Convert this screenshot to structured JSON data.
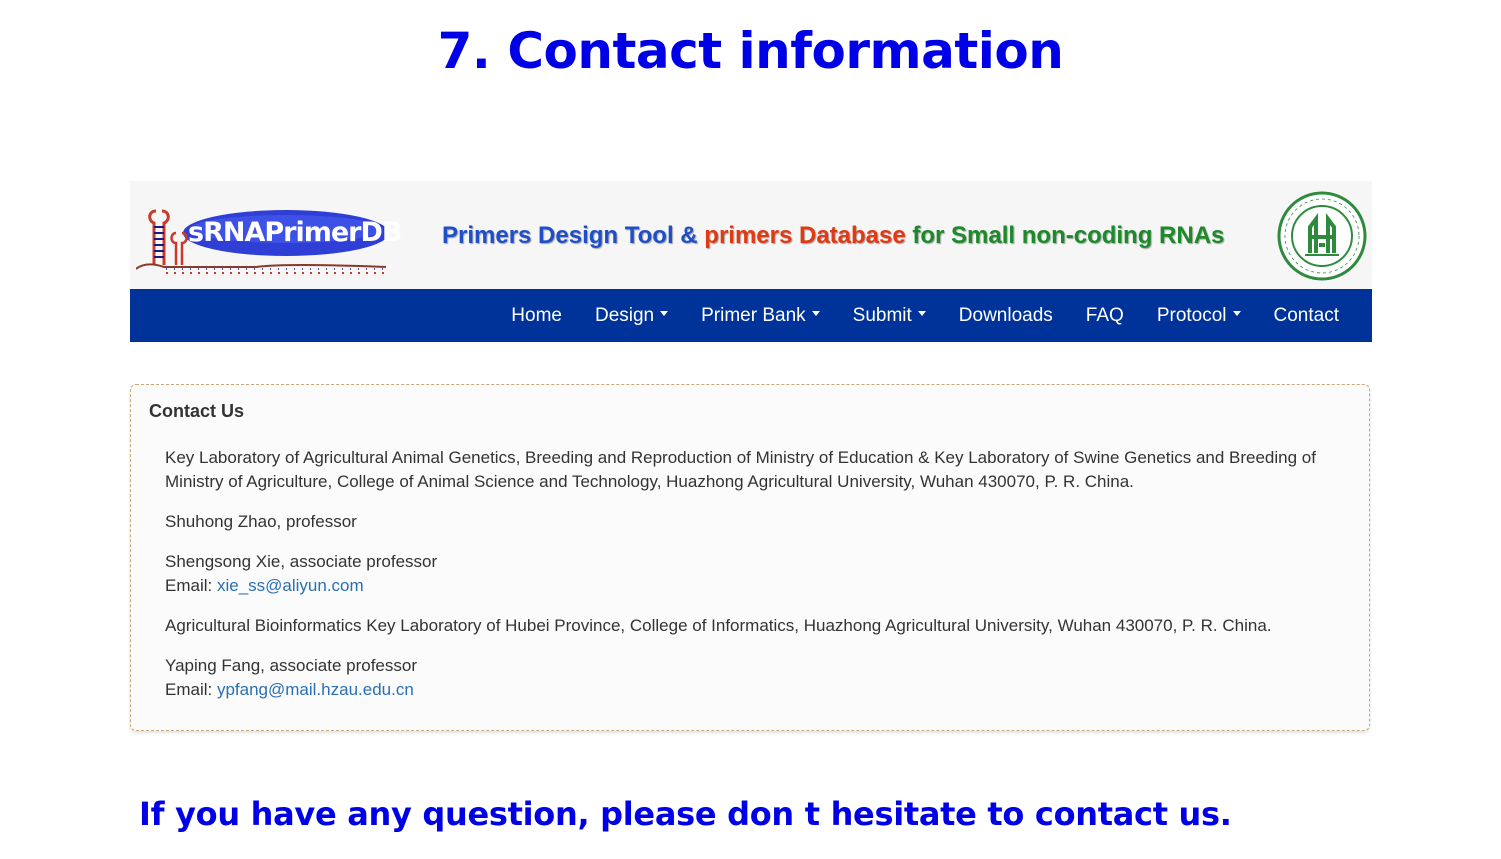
{
  "slide": {
    "title": "7. Contact information",
    "footer": "If you have any question, please don t hesitate to contact us."
  },
  "header": {
    "logo_text": "sRNAPrimerDB",
    "tagline": {
      "part1": "Primers Design Tool &",
      "part2": "primers Database",
      "part3": "for Small non-coding RNAs"
    },
    "seal_icon": "university-seal-icon"
  },
  "nav": {
    "items": [
      {
        "label": "Home",
        "dropdown": false
      },
      {
        "label": "Design",
        "dropdown": true
      },
      {
        "label": "Primer Bank",
        "dropdown": true
      },
      {
        "label": "Submit",
        "dropdown": true
      },
      {
        "label": "Downloads",
        "dropdown": false
      },
      {
        "label": "FAQ",
        "dropdown": false
      },
      {
        "label": "Protocol",
        "dropdown": true
      },
      {
        "label": "Contact",
        "dropdown": false
      }
    ]
  },
  "contact": {
    "heading": "Contact Us",
    "lab1": "Key Laboratory of Agricultural Animal Genetics, Breeding and Reproduction of Ministry of Education & Key Laboratory of Swine Genetics and Breeding of Ministry of Agriculture, College of Animal Science and Technology, Huazhong Agricultural University, Wuhan 430070, P. R. China.",
    "person1": "Shuhong Zhao, professor",
    "person2": "Shengsong Xie, associate professor",
    "email_label": "Email:",
    "email2": "xie_ss@aliyun.com",
    "lab2": "Agricultural Bioinformatics Key Laboratory of Hubei Province, College of Informatics, Huazhong Agricultural University, Wuhan 430070, P. R. China.",
    "person3": "Yaping Fang, associate professor",
    "email3": "ypfang@mail.hzau.edu.cn"
  },
  "colors": {
    "title_blue": "#0000e6",
    "nav_bg": "#003399",
    "link": "#2a6fb5",
    "tag_blue": "#1f4fc8",
    "tag_red": "#e03a14",
    "tag_green": "#1d8a2a"
  }
}
